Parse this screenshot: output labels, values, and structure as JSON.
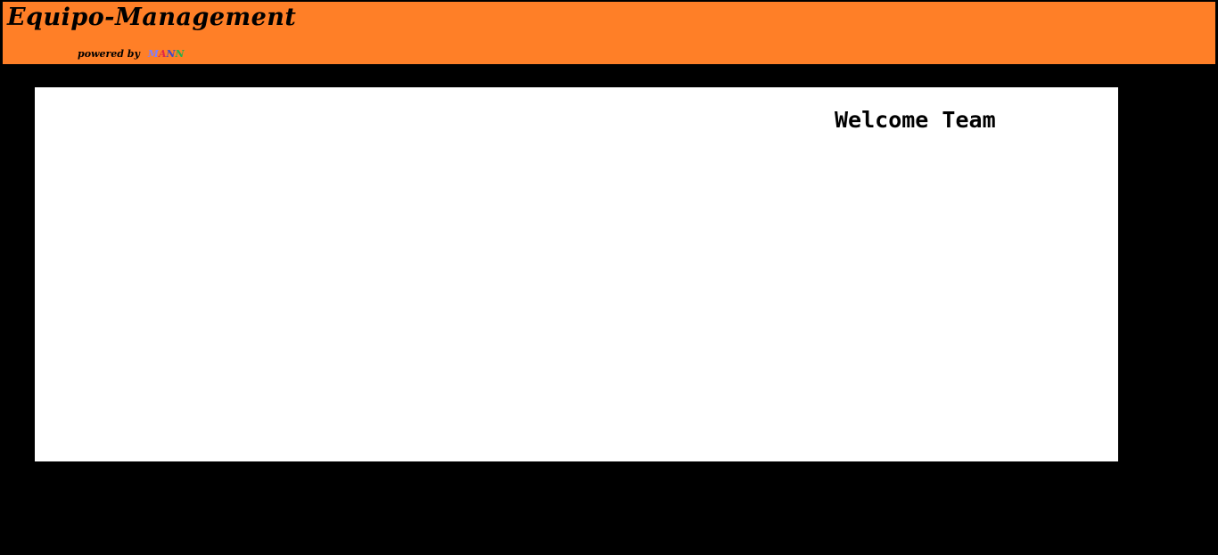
{
  "header": {
    "title": "Equipo-Management",
    "powered_by": "powered by",
    "brand": {
      "text": "MANN",
      "letters": [
        {
          "char": "M",
          "color": "#7f7fff"
        },
        {
          "char": "A",
          "color": "#e0284a"
        },
        {
          "char": "N",
          "color": "#3f48cc"
        },
        {
          "char": "N",
          "color": "#22b14c"
        }
      ]
    },
    "background_color": "#ff7f27"
  },
  "main": {
    "welcome_text": "Welcome Team",
    "panel_color": "#ffffff"
  },
  "page_background": "#000000"
}
